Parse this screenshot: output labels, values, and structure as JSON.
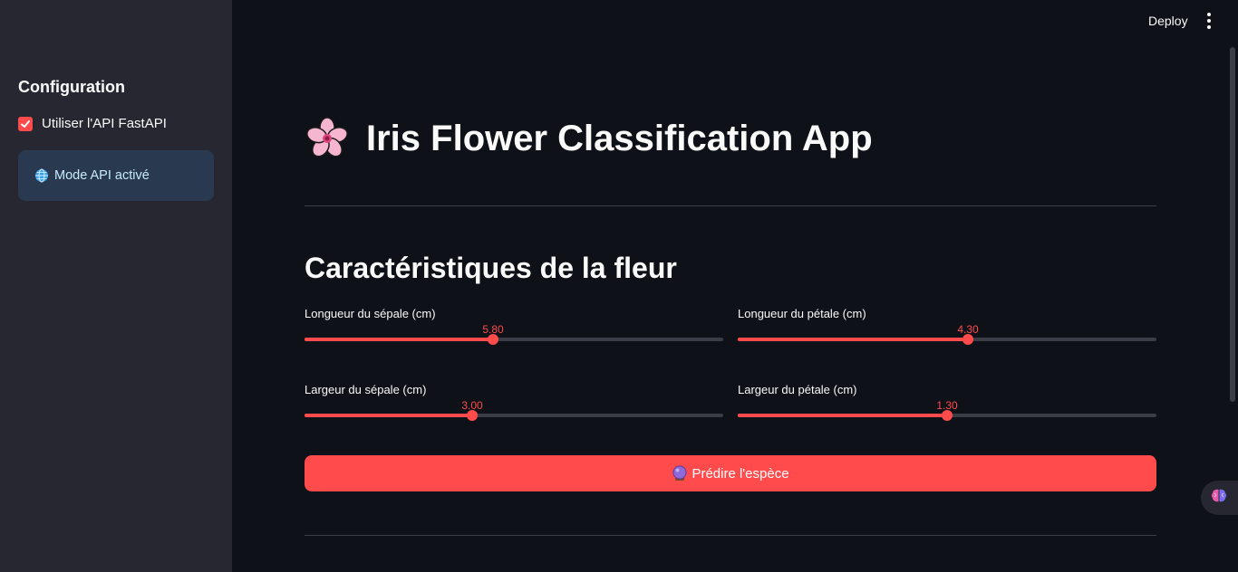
{
  "header": {
    "deploy_label": "Deploy",
    "menu_icon": "more-vertical-icon"
  },
  "sidebar": {
    "title": "Configuration",
    "checkbox": {
      "label": "Utiliser l'API FastAPI",
      "checked": true
    },
    "info": {
      "icon": "globe-icon",
      "text": "Mode API activé"
    }
  },
  "main": {
    "title": "Iris Flower Classification App",
    "title_icon": "cherry-blossom-icon",
    "section_title": "Caractéristiques de la fleur",
    "sliders": [
      {
        "label": "Longueur du sépale (cm)",
        "value": "5.80",
        "fraction": 0.45
      },
      {
        "label": "Longueur du pétale (cm)",
        "value": "4.30",
        "fraction": 0.55
      },
      {
        "label": "Largeur du sépale (cm)",
        "value": "3.00",
        "fraction": 0.4
      },
      {
        "label": "Largeur du pétale (cm)",
        "value": "1.30",
        "fraction": 0.5
      }
    ],
    "predict_button": {
      "label": "Prédire l'espèce",
      "icon": "crystal-ball-icon"
    }
  },
  "floating": {
    "icon": "brain-icon"
  },
  "colors": {
    "accent": "#ff4b4b",
    "background": "#0e1117",
    "sidebar": "#262730",
    "info_bg": "#29394f"
  }
}
